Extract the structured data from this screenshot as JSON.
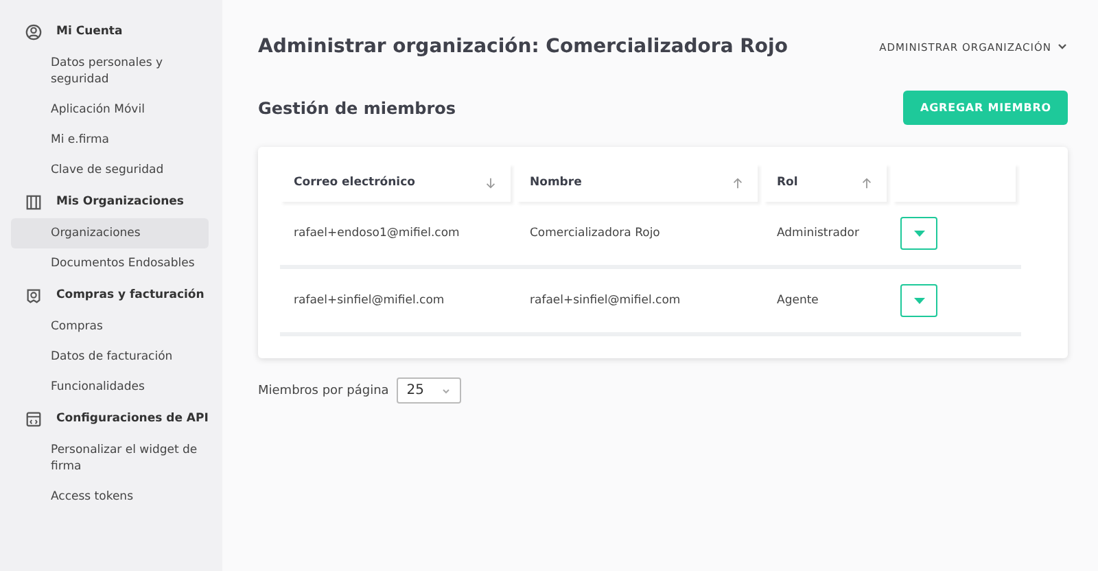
{
  "sidebar": {
    "sections": [
      {
        "title": "Mi Cuenta",
        "items": [
          {
            "label": "Datos personales y seguridad",
            "selected": false
          },
          {
            "label": "Aplicación Móvil",
            "selected": false
          },
          {
            "label": "Mi e.firma",
            "selected": false
          },
          {
            "label": "Clave de seguridad",
            "selected": false
          }
        ]
      },
      {
        "title": "Mis Organizaciones",
        "items": [
          {
            "label": "Organizaciones",
            "selected": true
          },
          {
            "label": "Documentos Endosables",
            "selected": false
          }
        ]
      },
      {
        "title": "Compras y facturación",
        "items": [
          {
            "label": "Compras",
            "selected": false
          },
          {
            "label": "Datos de facturación",
            "selected": false
          },
          {
            "label": "Funcionalidades",
            "selected": false
          }
        ]
      },
      {
        "title": "Configuraciones de API",
        "items": [
          {
            "label": "Personalizar el widget de firma",
            "selected": false
          },
          {
            "label": "Access tokens",
            "selected": false
          }
        ]
      }
    ]
  },
  "header": {
    "title": "Administrar organización: Comercializadora Rojo",
    "menu": "ADMINISTRAR ORGANIZACIÓN"
  },
  "section": {
    "title": "Gestión de miembros",
    "button": "AGREGAR MIEMBRO"
  },
  "table": {
    "columns": [
      {
        "label": "Correo electrónico",
        "descending": true
      },
      {
        "label": "Nombre",
        "descending": false
      },
      {
        "label": "Rol",
        "descending": false
      }
    ],
    "rows": [
      {
        "cells": [
          "rafael+endoso1@mifiel.com",
          "Comercializadora Rojo",
          "Administrador"
        ]
      },
      {
        "cells": [
          "rafael+sinfiel@mifiel.com",
          "rafael+sinfiel@mifiel.com",
          "Agente"
        ]
      }
    ]
  },
  "pagination": {
    "label": "Miembros por página",
    "value": "25"
  }
}
